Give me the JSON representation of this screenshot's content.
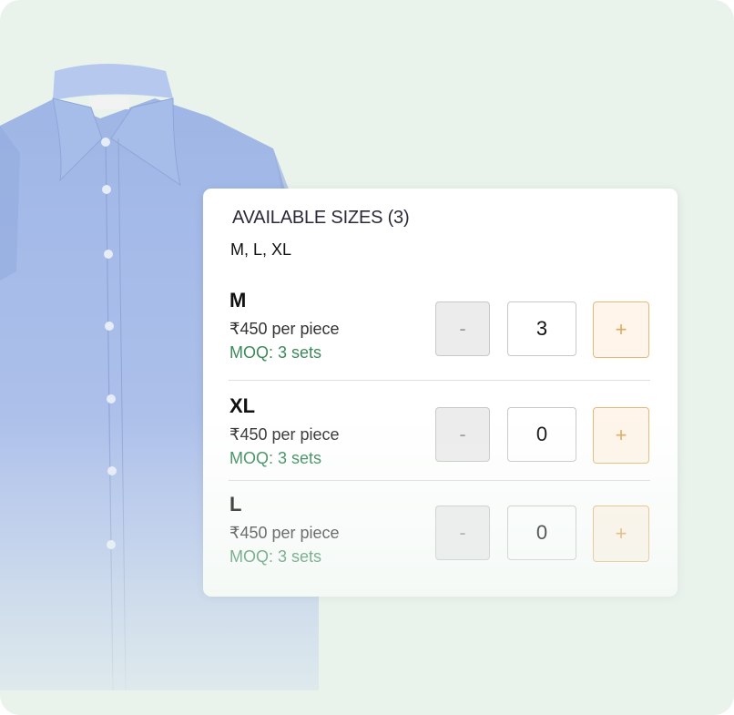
{
  "panel": {
    "title": "AVAILABLE SIZES (3)",
    "size_list": "M, L, XL"
  },
  "sizes": [
    {
      "name": "M",
      "price": "₹450 per piece",
      "moq": "MOQ: 3 sets",
      "quantity": "3",
      "minus_label": "-",
      "plus_label": "+"
    },
    {
      "name": "XL",
      "price": "₹450 per piece",
      "moq": "MOQ: 3 sets",
      "quantity": "0",
      "minus_label": "-",
      "plus_label": "+"
    },
    {
      "name": "L",
      "price": "₹450 per piece",
      "moq": "MOQ: 3 sets",
      "quantity": "0",
      "minus_label": "-",
      "plus_label": "+"
    }
  ],
  "colors": {
    "background": "#e9f3ec",
    "moq_text": "#3c8a5c",
    "plus_border": "#e8b878",
    "shirt": "#a9bfe8"
  }
}
